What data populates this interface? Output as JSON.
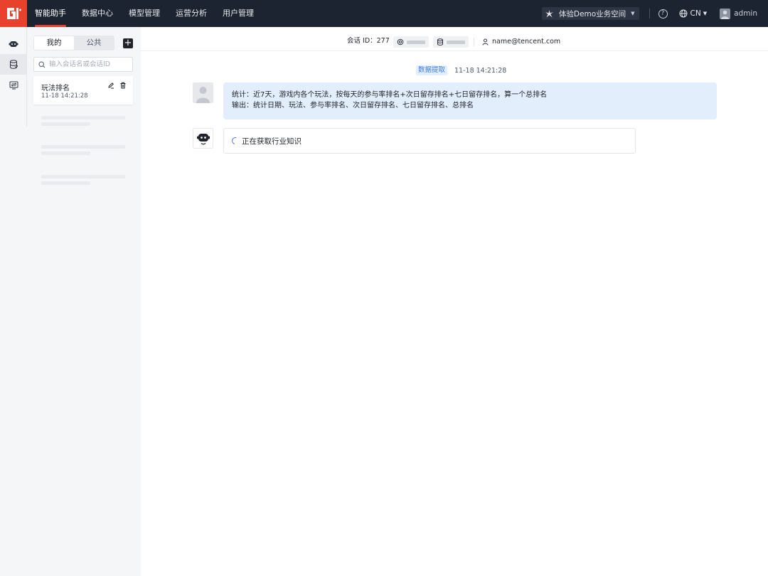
{
  "nav": {
    "items": [
      {
        "label": "智能助手",
        "active": true
      },
      {
        "label": "数据中心",
        "active": false
      },
      {
        "label": "模型管理",
        "active": false
      },
      {
        "label": "运营分析",
        "active": false
      },
      {
        "label": "用户管理",
        "active": false
      }
    ],
    "workspace": "体验Demo业务空间",
    "language": "CN",
    "user": "admin",
    "logo_icon": "logo-icon",
    "accent_color": "#e8412c",
    "bar_color": "#1d2431"
  },
  "rail": {
    "items": [
      {
        "icon": "robot-icon",
        "active": false
      },
      {
        "icon": "database-icon",
        "active": true
      },
      {
        "icon": "transfer-icon",
        "active": false
      }
    ]
  },
  "sessions": {
    "tabs": [
      "我的",
      "公共"
    ],
    "active_tab": "我的",
    "search_placeholder": "输入会话名或会话ID",
    "items": [
      {
        "title": "玩法排名",
        "time": "11-18 14:21:28"
      }
    ]
  },
  "info": {
    "session_label": "会话 ID：",
    "session_id": "277",
    "email": "name@tencent.com"
  },
  "chat": {
    "tag": "数据提取",
    "time": "11-18 14:21:28",
    "user_lines": [
      "统计：近7天，游戏内各个玩法，按每天的参与率排名+次日留存排名+七日留存排名，算一个总排名",
      "输出：统计日期、玩法、参与率排名、次日留存排名、七日留存排名、总排名"
    ],
    "bot_status": "正在获取行业知识",
    "tag_color": "#3d7ee8",
    "bubble_color": "#e3eefd"
  }
}
